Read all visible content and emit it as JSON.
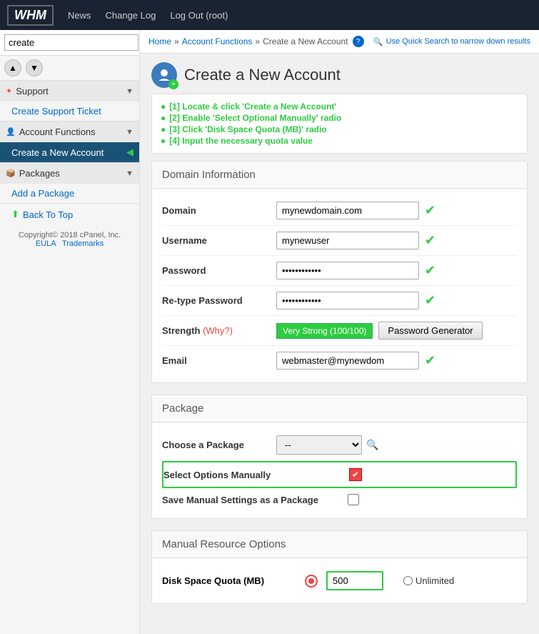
{
  "topnav": {
    "logo": "WHM",
    "links": [
      "News",
      "Change Log",
      "Log Out (root)"
    ]
  },
  "sidebar": {
    "search_value": "create",
    "support_label": "Support",
    "create_ticket_label": "Create Support Ticket",
    "account_functions_label": "Account Functions",
    "create_account_label": "Create a New Account",
    "packages_label": "Packages",
    "add_package_label": "Add a Package",
    "back_to_top_label": "Back To Top",
    "copyright": "Copyright© 2018 cPanel, Inc.",
    "eula_label": "EULA",
    "trademarks_label": "Trademarks"
  },
  "breadcrumb": {
    "home": "Home",
    "account_functions": "Account Functions",
    "current": "Create a New Account",
    "quick_search_note": "Use Quick Search to narrow down results"
  },
  "page_title": "Create a New Account",
  "callout": {
    "items": [
      "[1] Locate & click 'Create a New Account'",
      "[2] Enable 'Select Optional Manually' radio",
      "[3] Click 'Disk Space Quota (MB)' radio",
      "[4] Input the necessary quota value"
    ]
  },
  "domain_section": {
    "title": "Domain Information",
    "domain_label": "Domain",
    "domain_value": "mynewdomain.com",
    "username_label": "Username",
    "username_value": "mynewuser",
    "password_label": "Password",
    "password_value": "············",
    "retype_label": "Re-type Password",
    "retype_value": "············",
    "strength_label": "Strength",
    "why_label": "(Why?)",
    "strength_value": "Very Strong (100/100)",
    "pwd_gen_label": "Password Generator",
    "email_label": "Email",
    "email_value": "webmaster@mynewdom"
  },
  "package_section": {
    "title": "Package",
    "choose_label": "Choose a Package",
    "choose_placeholder": "--",
    "select_manually_label": "Select Options Manually",
    "save_manual_label": "Save Manual Settings as a Package"
  },
  "manual_resource_section": {
    "title": "Manual Resource Options",
    "disk_label": "Disk Space Quota (MB)",
    "quota_value": "500",
    "unlimited_label": "Unlimited"
  }
}
